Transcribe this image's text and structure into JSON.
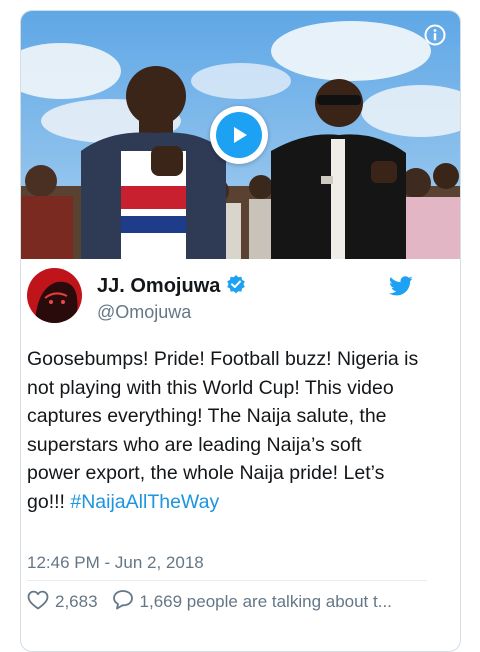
{
  "video": {
    "play_icon": "play-icon",
    "info_icon": "info-icon"
  },
  "author": {
    "name": "JJ. Omojuwa",
    "handle": "@Omojuwa",
    "verified_icon": "verified-badge-icon",
    "platform_icon": "twitter-bird-icon"
  },
  "tweet": {
    "text": "Goosebumps! Pride! Football buzz! Nigeria is not playing with this World Cup! This video captures everything! The Naija salute, the superstars who are leading Naija’s soft power export, the whole Naija pride! Let’s go!!!",
    "hashtag": "#NaijaAllTheWay",
    "timestamp": "12:46 PM - Jun 2, 2018"
  },
  "actions": {
    "likes": "2,683",
    "talking": "1,669 people are talking about t..."
  },
  "colors": {
    "accent": "#1da1f2",
    "link": "#1b95e0",
    "muted": "#657786"
  }
}
